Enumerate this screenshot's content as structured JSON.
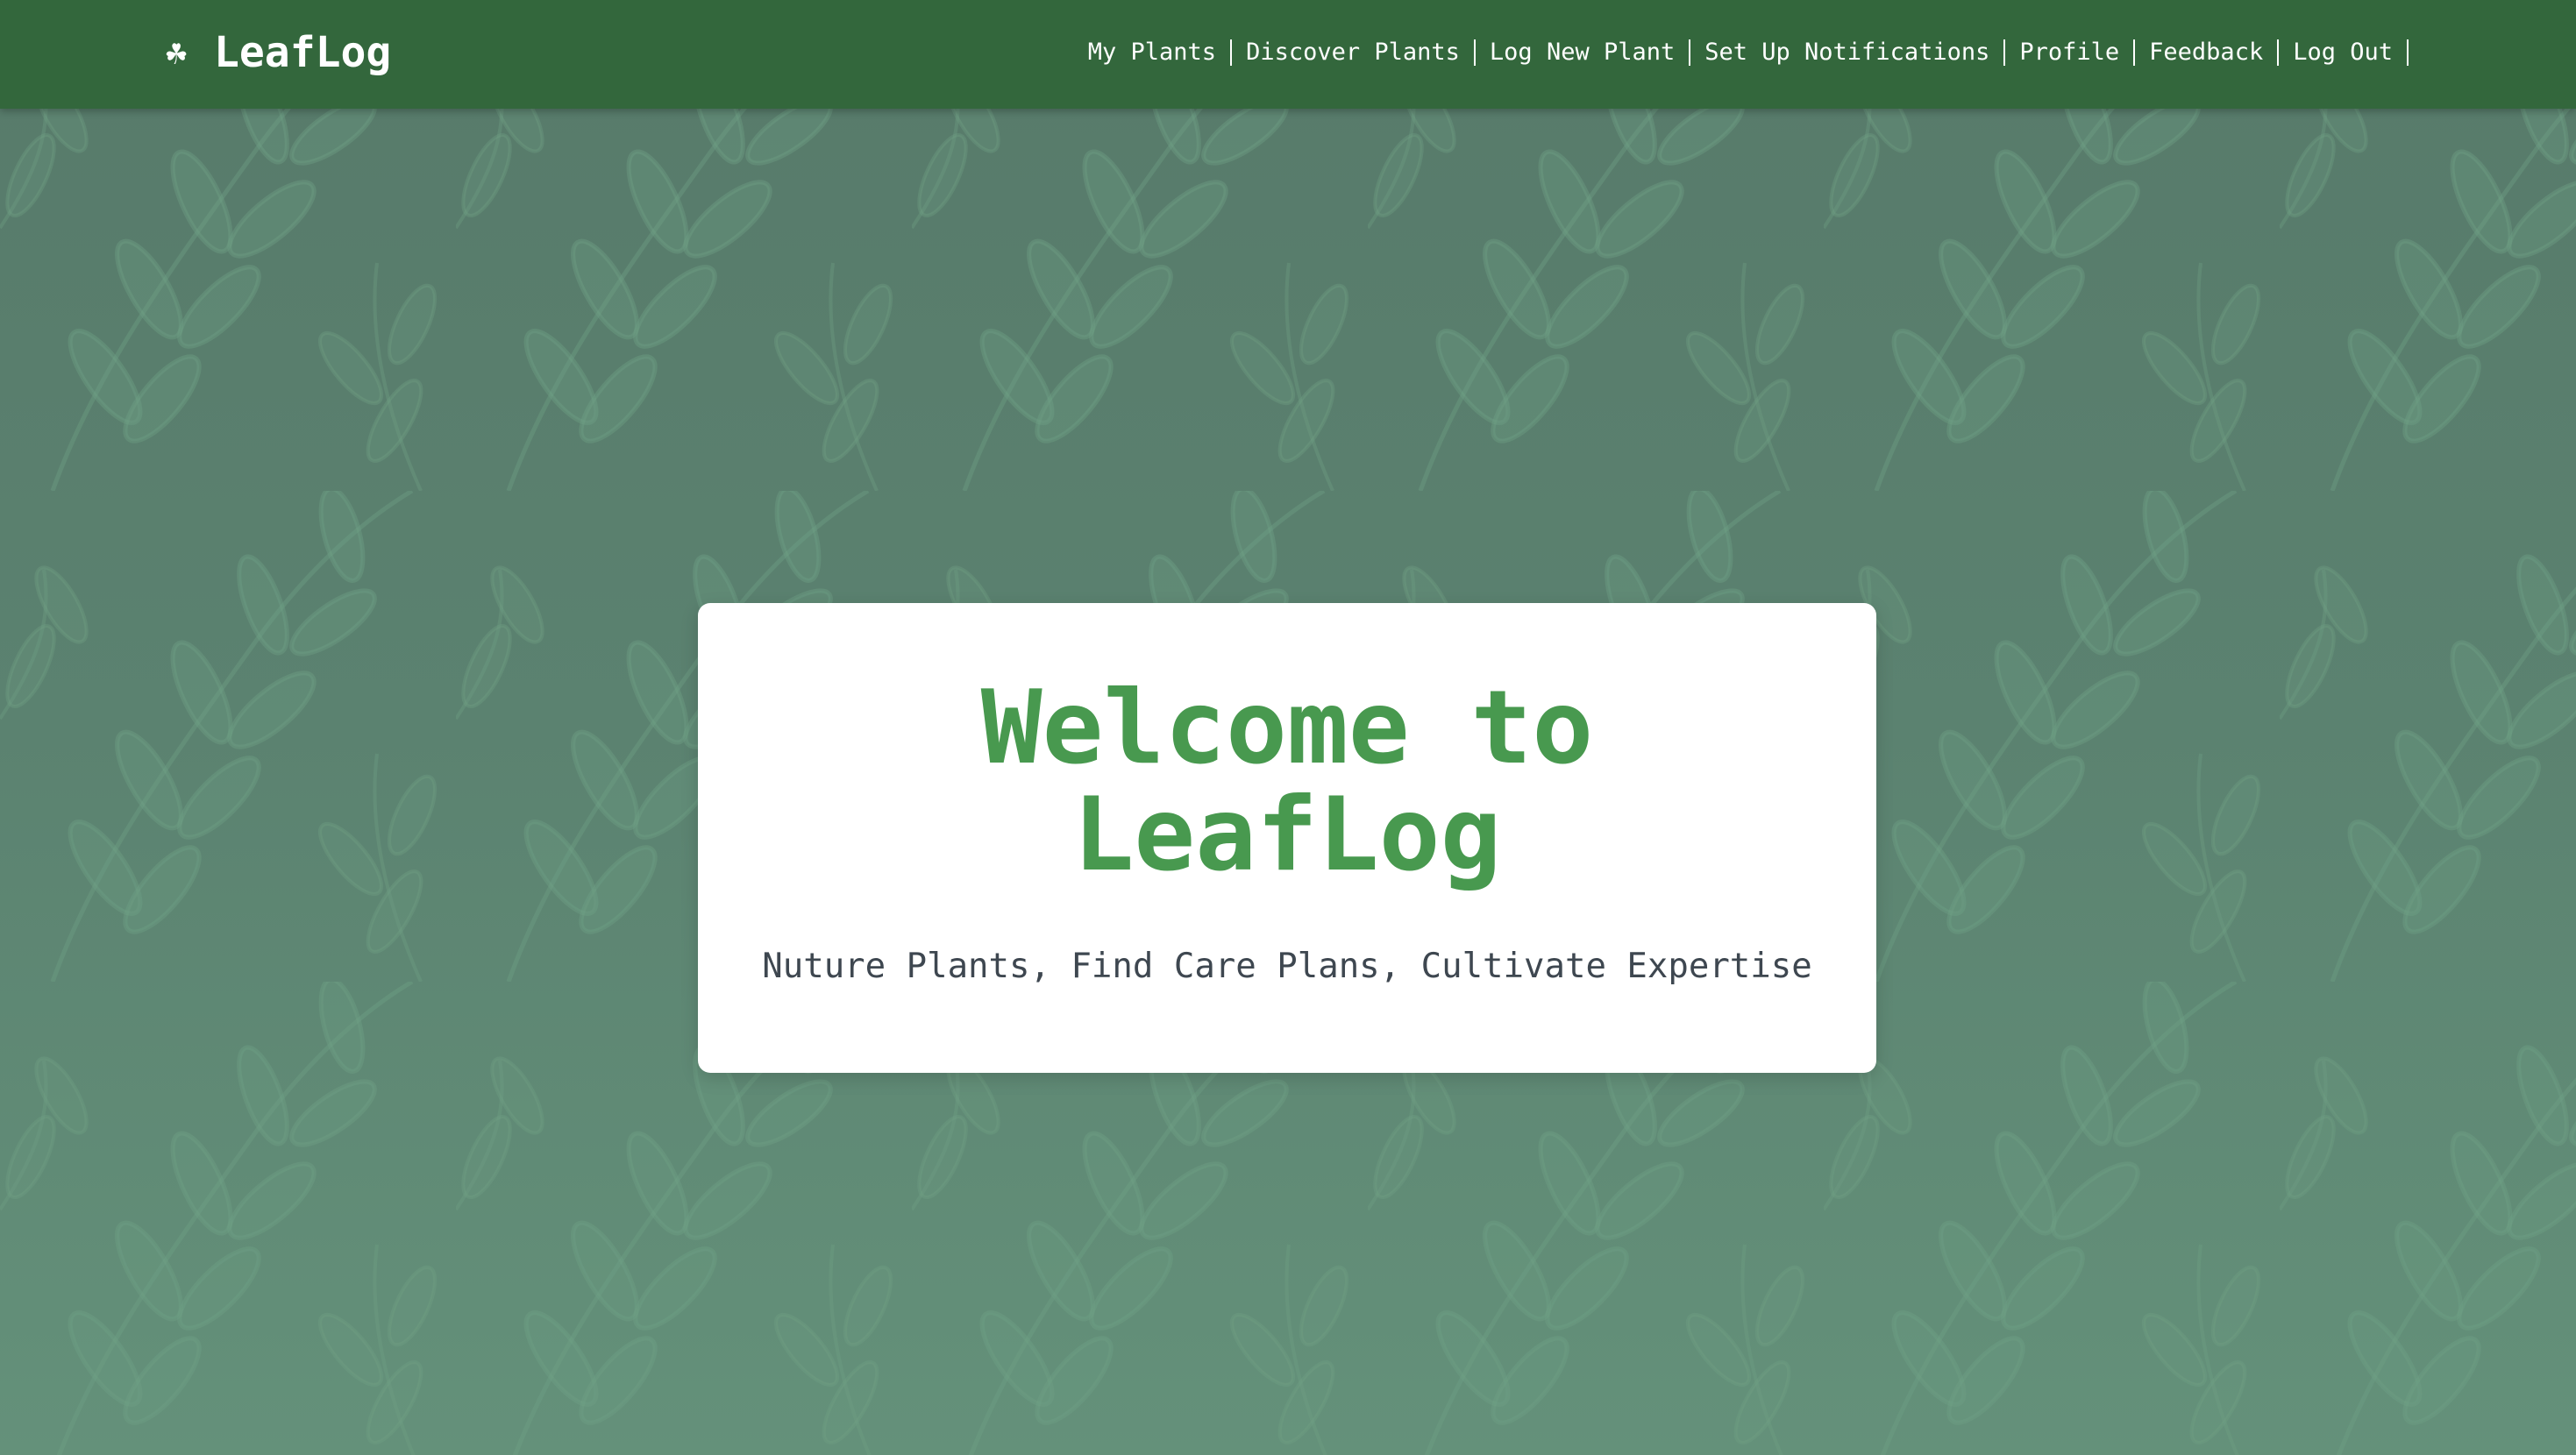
{
  "brand": {
    "icon": "shamrock-icon",
    "glyph": "☘",
    "name": "LeafLog"
  },
  "nav": {
    "items": [
      {
        "label": "My Plants"
      },
      {
        "label": "Discover Plants"
      },
      {
        "label": "Log New Plant"
      },
      {
        "label": "Set Up Notifications"
      },
      {
        "label": "Profile"
      },
      {
        "label": "Feedback"
      },
      {
        "label": "Log Out"
      }
    ]
  },
  "hero": {
    "title": "Welcome to LeafLog",
    "subtitle": "Nuture Plants, Find Care Plans, Cultivate Expertise"
  },
  "colors": {
    "navbar": "#33673c",
    "title_green": "#48994f",
    "background": "#5a7f6e",
    "card": "#ffffff"
  }
}
